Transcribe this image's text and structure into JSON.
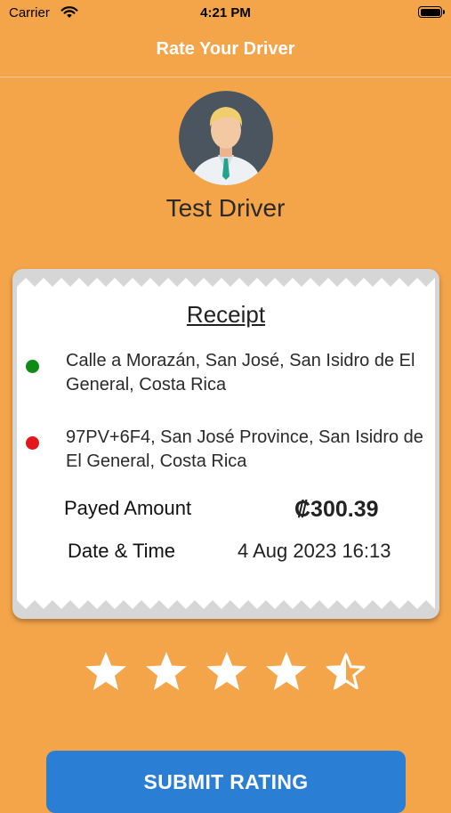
{
  "status_bar": {
    "carrier": "Carrier",
    "time": "4:21 PM"
  },
  "nav": {
    "title": "Rate Your Driver"
  },
  "driver": {
    "name": "Test Driver"
  },
  "receipt": {
    "title": "Receipt",
    "pickup": {
      "address": "Calle a Morazán, San José, San Isidro de El General, Costa Rica",
      "dot_color": "#0E8A17"
    },
    "dropoff": {
      "address": "97PV+6F4, San José Province, San Isidro de El General, Costa Rica",
      "dot_color": "#E2161B"
    },
    "amount_label": "Payed Amount",
    "amount_value": "₡300.39",
    "datetime_label": "Date & Time",
    "datetime_value": "4 Aug 2023 16:13"
  },
  "rating": {
    "value": 4.5,
    "max": 5
  },
  "submit": {
    "label": "SUBMIT RATING"
  },
  "colors": {
    "background": "#F4A54A",
    "button": "#2A7FD4"
  }
}
